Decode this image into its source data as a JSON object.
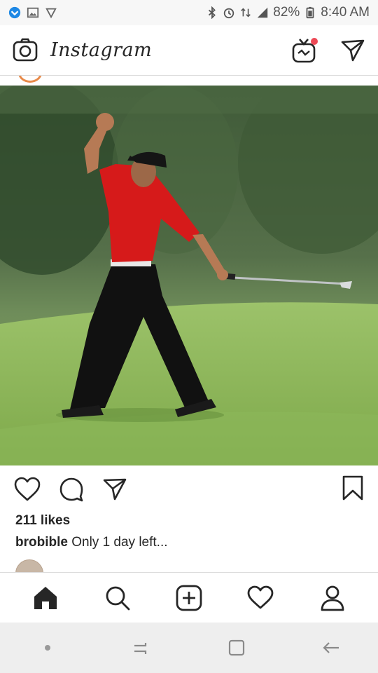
{
  "status_bar": {
    "battery": "82%",
    "time": "8:40 AM",
    "icons": [
      "notification-icon",
      "gallery-icon",
      "vpn-icon",
      "bluetooth-icon",
      "alarm-icon",
      "data-icon",
      "signal-icon",
      "battery-icon"
    ]
  },
  "header": {
    "logo": "Instagram",
    "left_icon": "camera-icon",
    "right_icons": [
      "igtv-icon",
      "direct-message-icon"
    ]
  },
  "post": {
    "likes": "211 likes",
    "caption_user": "brobible",
    "caption_text": "Only 1 day left..."
  },
  "bottom_nav": {
    "items": [
      "home-icon",
      "search-icon",
      "add-post-icon",
      "activity-heart-icon",
      "profile-icon"
    ]
  },
  "colors": {
    "notification_dot": "#ed4956",
    "text": "#262626",
    "divider": "#dbdbdb"
  }
}
